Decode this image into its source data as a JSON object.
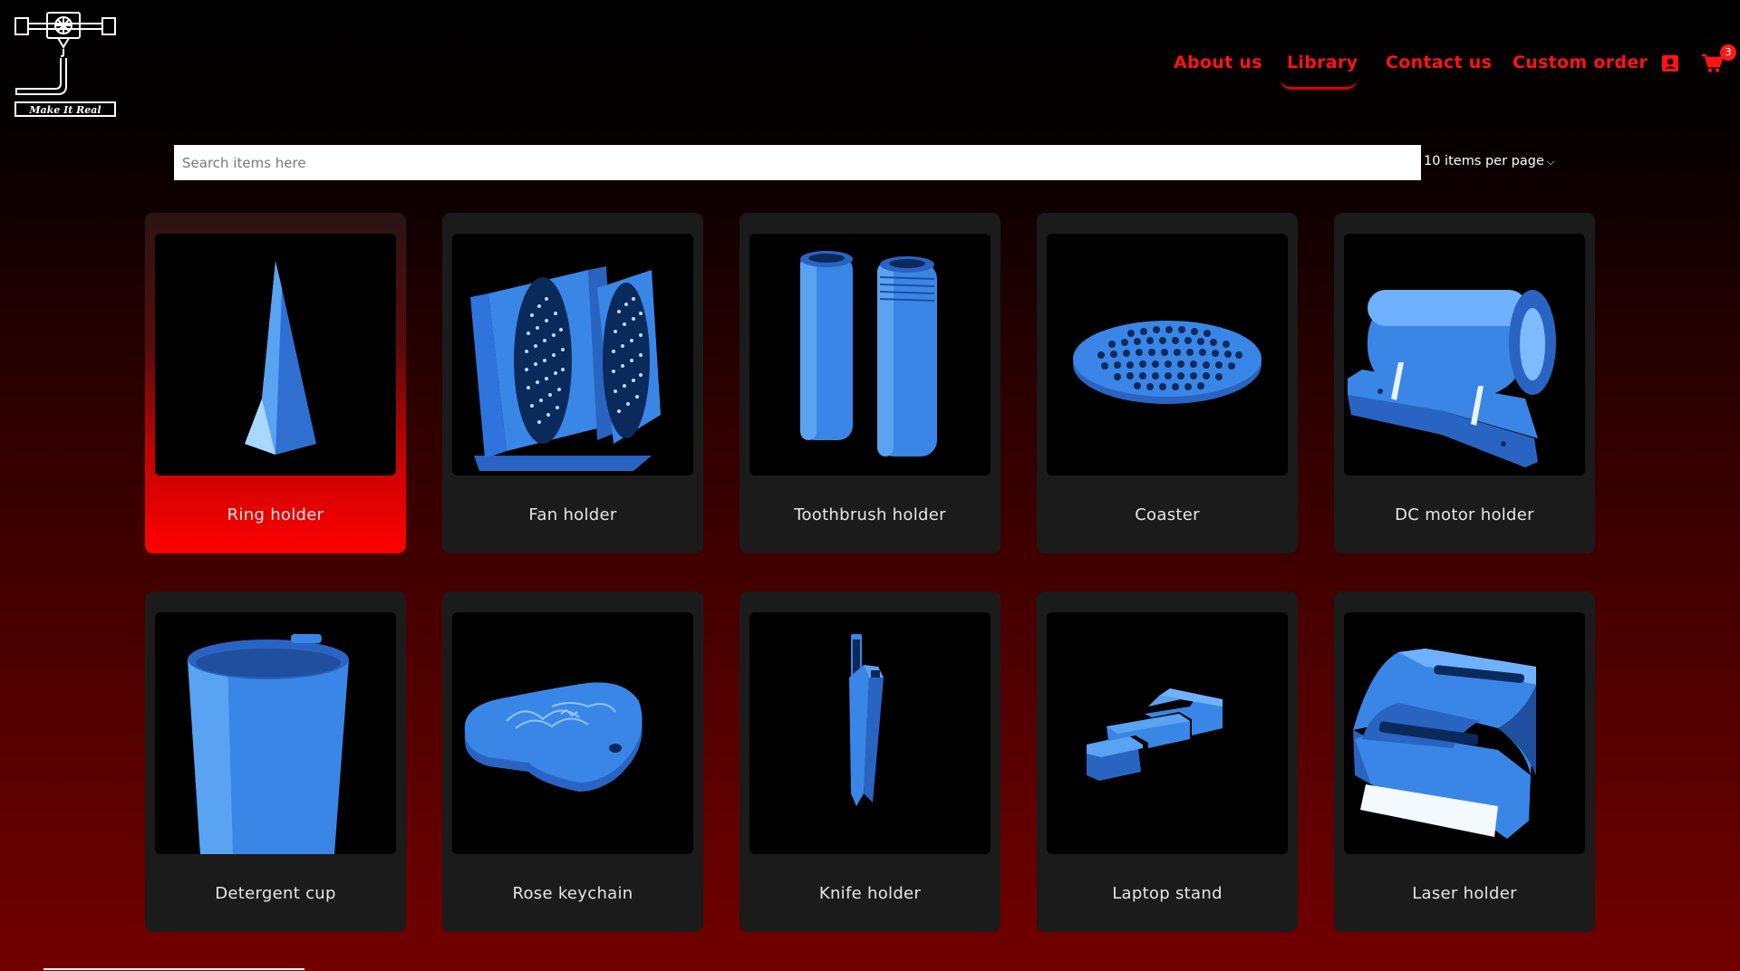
{
  "logo": {
    "text": "Make It Real"
  },
  "nav": {
    "items": [
      {
        "label": "About us"
      },
      {
        "label": "Library"
      },
      {
        "label": "Contact us"
      },
      {
        "label": "Custom order"
      }
    ],
    "active": "Library",
    "cart_count": "3"
  },
  "search": {
    "placeholder": "Search items here",
    "value": ""
  },
  "per_page": {
    "label": "10 items per page"
  },
  "items": [
    {
      "name": "Ring holder",
      "icon": "ring-holder-model"
    },
    {
      "name": "Fan holder",
      "icon": "fan-holder-model"
    },
    {
      "name": "Toothbrush holder",
      "icon": "toothbrush-holder-model"
    },
    {
      "name": "Coaster",
      "icon": "coaster-model"
    },
    {
      "name": "DC motor holder",
      "icon": "dc-motor-holder-model"
    },
    {
      "name": "Detergent cup",
      "icon": "detergent-cup-model"
    },
    {
      "name": "Rose keychain",
      "icon": "rose-keychain-model"
    },
    {
      "name": "Knife holder",
      "icon": "knife-holder-model"
    },
    {
      "name": "Laptop stand",
      "icon": "laptop-stand-model"
    },
    {
      "name": "Laser holder",
      "icon": "laser-holder-model"
    }
  ],
  "colors": {
    "accent": "#ff1414",
    "model_blue": "#3a86e6",
    "card_bg": "#1b1b1b",
    "highlight": "#ff0000"
  }
}
